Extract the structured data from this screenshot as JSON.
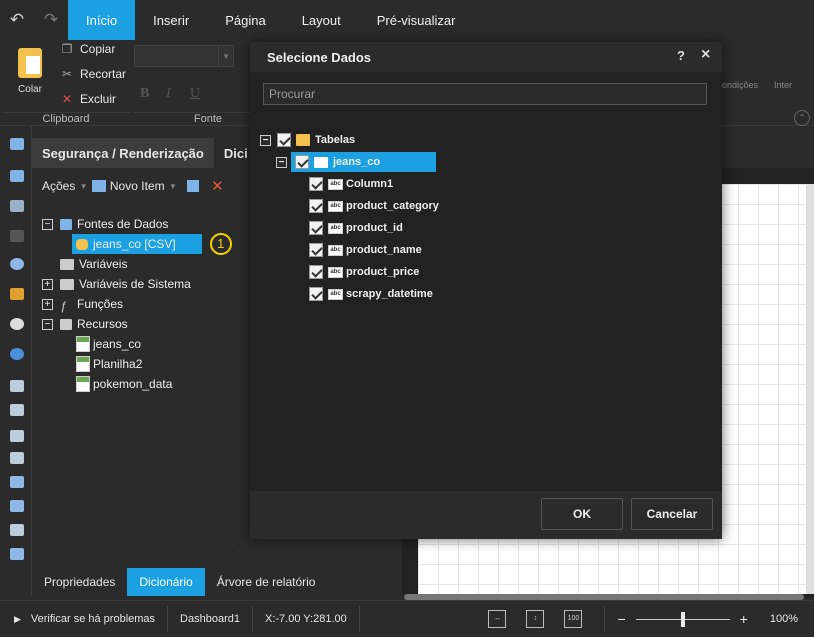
{
  "menu": {
    "tabs": [
      "Início",
      "Inserir",
      "Página",
      "Layout",
      "Pré-visualizar"
    ],
    "active_index": 0
  },
  "ribbon": {
    "paste_label": "Colar",
    "copy_label": "Copiar",
    "cut_label": "Recortar",
    "delete_label": "Excluir",
    "group_clipboard": "Clipboard",
    "group_font": "Fonte",
    "right_labels": [
      "ondições",
      "Inter"
    ]
  },
  "panel": {
    "tabs": [
      "Segurança / Renderização",
      "Dici"
    ],
    "toolbar": {
      "actions_label": "Ações",
      "new_item_label": "Novo Item"
    },
    "tree": {
      "datasources": "Fontes de Dados",
      "datasource_item": "jeans_co [CSV]",
      "badge": "1",
      "variables": "Variáveis",
      "system_variables": "Variáveis de Sistema",
      "functions": "Funções",
      "resources": "Recursos",
      "resource_items": [
        "jeans_co",
        "Planilha2",
        "pokemon_data"
      ]
    }
  },
  "bottom_tabs": {
    "tabs": [
      "Propriedades",
      "Dicionário",
      "Árvore de relatório"
    ],
    "active_index": 1
  },
  "status": {
    "check_label": "Verificar se há problemas",
    "page_name": "Dashboard1",
    "coords": "X:-7.00 Y:281.00",
    "zoom": "100%",
    "zoom_fraction": 0.5
  },
  "modal": {
    "title": "Selecione Dados",
    "help": "?",
    "close": "×",
    "search_placeholder": "Procurar",
    "root": "Tabelas",
    "table": "jeans_co",
    "columns": [
      "Column1",
      "product_category",
      "product_id",
      "product_name",
      "product_price",
      "scrapy_datetime"
    ],
    "ok_label": "OK",
    "cancel_label": "Cancelar"
  },
  "colors": {
    "accent": "#1ba1e2",
    "badge": "#f5d300",
    "background": "#2b2b2b"
  }
}
